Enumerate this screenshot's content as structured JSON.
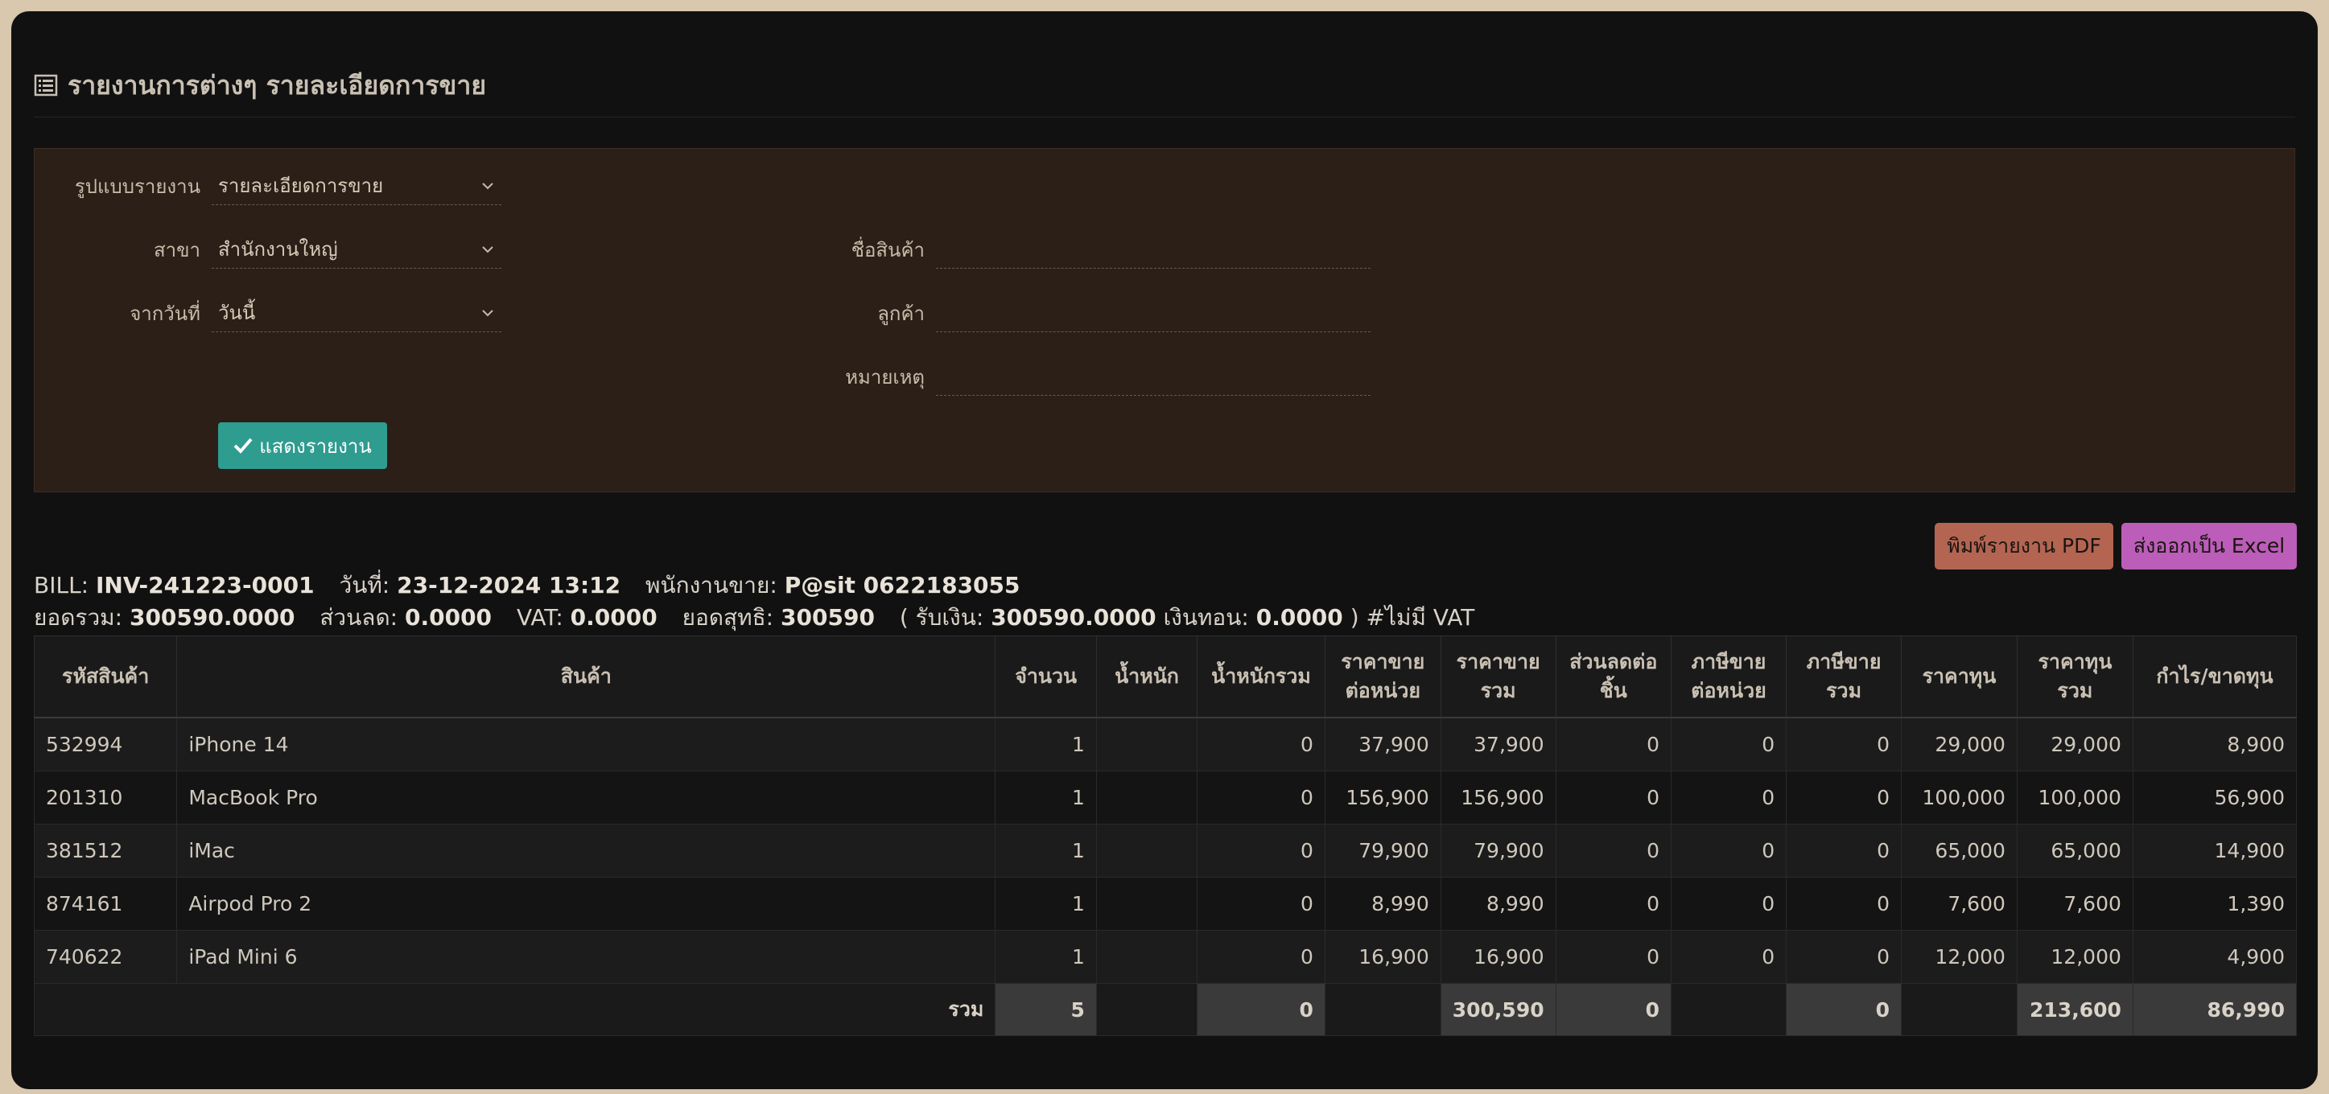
{
  "header": {
    "title": "รายงานการต่างๆ รายละเอียดการขาย",
    "icon": "list-icon"
  },
  "filters": {
    "report_type": {
      "label": "รูปแบบรายงาน",
      "value": "รายละเอียดการขาย"
    },
    "branch": {
      "label": "สาขา",
      "value": "สำนักงานใหญ่"
    },
    "from_date": {
      "label": "จากวันที่",
      "value": "วันนี้"
    },
    "product_name": {
      "label": "ชื่อสินค้า",
      "value": ""
    },
    "customer": {
      "label": "ลูกค้า",
      "value": ""
    },
    "note": {
      "label": "หมายเหตุ",
      "value": ""
    },
    "show_button": "แสดงรายงาน"
  },
  "actions": {
    "print_pdf": "พิมพ์รายงาน PDF",
    "export_excel": "ส่งออกเป็น Excel"
  },
  "bill": {
    "bill_label": "BILL:",
    "bill_no": "INV-241223-0001",
    "date_label": "วันที่:",
    "date": "23-12-2024 13:12",
    "staff_label": "พนักงานขาย:",
    "staff": "P@sit 0622183055",
    "total_label": "ยอดรวม:",
    "total": "300590.0000",
    "discount_label": "ส่วนลด:",
    "discount": "0.0000",
    "vat_label": "VAT:",
    "vat": "0.0000",
    "net_label": "ยอดสุทธิ:",
    "net": "300590",
    "received_label": "( รับเงิน:",
    "received": "300590.0000",
    "change_label": "เงินทอน:",
    "change": "0.0000",
    "suffix": ") #ไม่มี VAT"
  },
  "table": {
    "headers": [
      "รหัสสินค้า",
      "สินค้า",
      "จำนวน",
      "น้ำหนัก",
      "น้ำหนักรวม",
      "ราคาขาย\nต่อหน่วย",
      "ราคาขาย\nรวม",
      "ส่วนลดต่อ\nชิ้น",
      "ภาษีขาย\nต่อหน่วย",
      "ภาษีขาย\nรวม",
      "ราคาทุน",
      "ราคาทุน\nรวม",
      "กำไร/ขาดทุน"
    ],
    "rows": [
      [
        "532994",
        "iPhone 14",
        "1",
        "",
        "0",
        "37,900",
        "37,900",
        "0",
        "0",
        "0",
        "29,000",
        "29,000",
        "8,900"
      ],
      [
        "201310",
        "MacBook Pro",
        "1",
        "",
        "0",
        "156,900",
        "156,900",
        "0",
        "0",
        "0",
        "100,000",
        "100,000",
        "56,900"
      ],
      [
        "381512",
        "iMac",
        "1",
        "",
        "0",
        "79,900",
        "79,900",
        "0",
        "0",
        "0",
        "65,000",
        "65,000",
        "14,900"
      ],
      [
        "874161",
        "Airpod Pro 2",
        "1",
        "",
        "0",
        "8,990",
        "8,990",
        "0",
        "0",
        "0",
        "7,600",
        "7,600",
        "1,390"
      ],
      [
        "740622",
        "iPad Mini 6",
        "1",
        "",
        "0",
        "16,900",
        "16,900",
        "0",
        "0",
        "0",
        "12,000",
        "12,000",
        "4,900"
      ]
    ],
    "footer": {
      "label": "รวม",
      "qty": "5",
      "weight": "",
      "weight_total": "0",
      "unit_price": "",
      "sale_total": "300,590",
      "discount": "0",
      "tax_unit": "",
      "tax_total": "0",
      "cost": "",
      "cost_total": "213,600",
      "profit": "86,990"
    }
  },
  "colors": {
    "accent_button": "#2f9c90",
    "pdf_button": "#b36552",
    "excel_button": "#bb5db9",
    "filter_bg": "#2b1f18"
  }
}
